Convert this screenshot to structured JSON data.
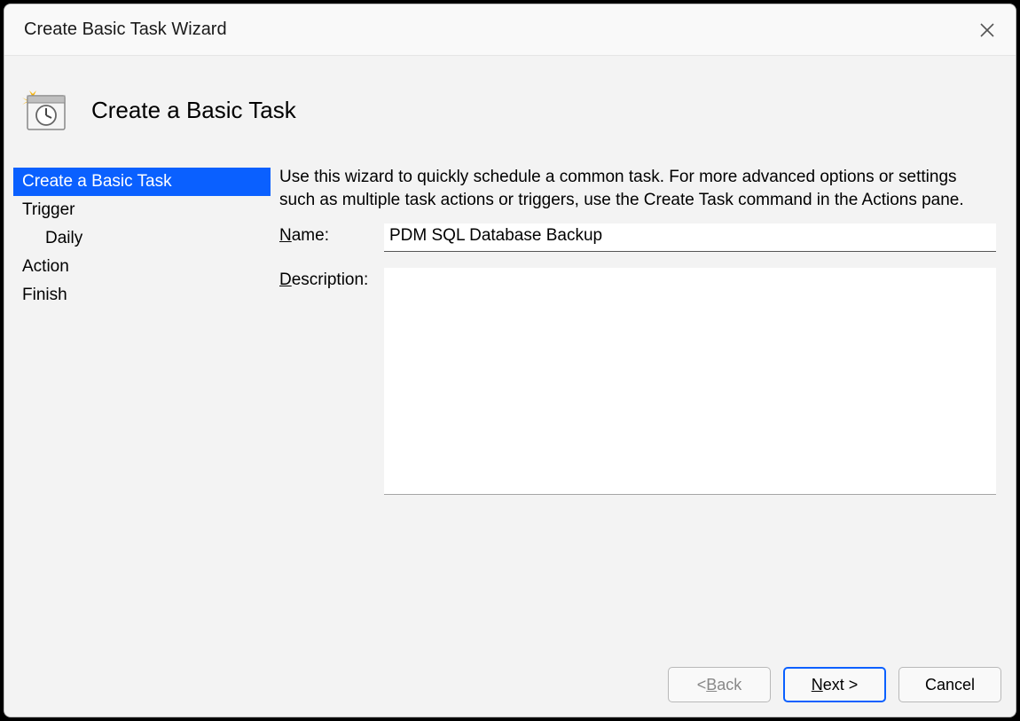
{
  "window": {
    "title": "Create Basic Task Wizard"
  },
  "header": {
    "title": "Create a Basic Task"
  },
  "sidebar": {
    "items": [
      {
        "label": "Create a Basic Task",
        "selected": true,
        "child": false
      },
      {
        "label": "Trigger",
        "selected": false,
        "child": false
      },
      {
        "label": "Daily",
        "selected": false,
        "child": true
      },
      {
        "label": "Action",
        "selected": false,
        "child": false
      },
      {
        "label": "Finish",
        "selected": false,
        "child": false
      }
    ]
  },
  "main": {
    "intro": "Use this wizard to quickly schedule a common task.  For more advanced options or settings such as multiple task actions or triggers, use the Create Task command in the Actions pane.",
    "name_label_prefix": "N",
    "name_label_rest": "ame:",
    "name_value": "PDM SQL Database Backup",
    "description_label_prefix": "D",
    "description_label_rest": "escription:",
    "description_value": ""
  },
  "buttons": {
    "back_prefix": "< ",
    "back_u": "B",
    "back_rest": "ack",
    "next_u": "N",
    "next_rest": "ext >",
    "cancel": "Cancel"
  }
}
